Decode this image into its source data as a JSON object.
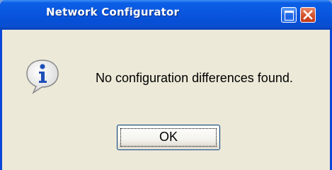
{
  "window": {
    "title": "Network Configurator"
  },
  "titlebar_buttons": [
    "maximize-icon",
    "close-icon"
  ],
  "dialog": {
    "icon": "info-icon",
    "message": "No configuration differences found.",
    "ok_label": "OK"
  },
  "colors": {
    "titlebar": "#0a56de",
    "client_background": "#ece9d8",
    "close_button": "#d4502c",
    "info_icon": "#1f4fb8"
  }
}
